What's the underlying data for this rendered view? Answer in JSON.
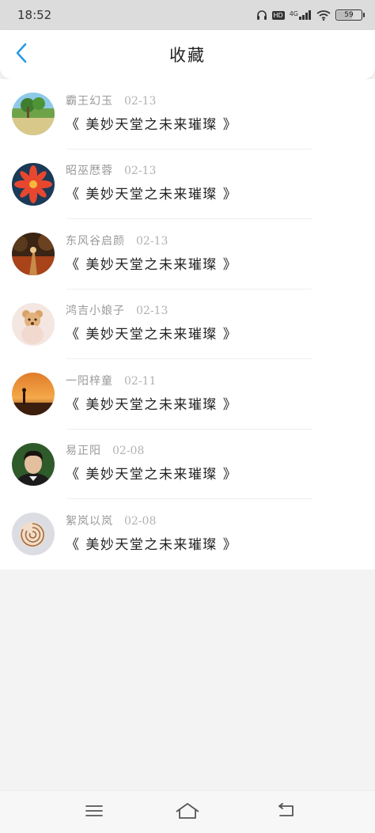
{
  "status": {
    "time": "18:52",
    "network": "4G",
    "hd": "HD",
    "battery": "59",
    "battery_level": 0.59
  },
  "nav": {
    "title": "收藏"
  },
  "items": [
    {
      "name": "霸王幻玉",
      "date": "02-13",
      "book": "《 美妙天堂之未来璀璨 》",
      "avatar": "landscape-avatar"
    },
    {
      "name": "昭巫厯蓉",
      "date": "02-13",
      "book": "《 美妙天堂之未来璀璨 》",
      "avatar": "red-flower-avatar"
    },
    {
      "name": "东风谷启颜",
      "date": "02-13",
      "book": "《 美妙天堂之未来璀璨 》",
      "avatar": "autumn-path-avatar"
    },
    {
      "name": "鸿吉小娘子",
      "date": "02-13",
      "book": "《 美妙天堂之未来璀璨 》",
      "avatar": "teddy-bear-avatar"
    },
    {
      "name": "一阳梓童",
      "date": "02-11",
      "book": "《 美妙天堂之未来璀璨 》",
      "avatar": "sunset-avatar"
    },
    {
      "name": "易正阳",
      "date": "02-08",
      "book": "《 美妙天堂之未来璀璨 》",
      "avatar": "man-portrait-avatar"
    },
    {
      "name": "絮岚以岚",
      "date": "02-08",
      "book": "《 美妙天堂之未来璀璨 》",
      "avatar": "nautilus-shell-avatar"
    }
  ],
  "colors": {
    "accent": "#2a9be0",
    "statusbar": "#dcdcdc",
    "page_bg": "#f3f3f3"
  },
  "icons": {
    "back": "chevron-left-icon",
    "headphones": "headphones-icon",
    "signal": "signal-icon",
    "wifi": "wifi-icon",
    "menu": "menu-icon",
    "home": "home-icon",
    "back_nav": "back-arrow-icon"
  }
}
